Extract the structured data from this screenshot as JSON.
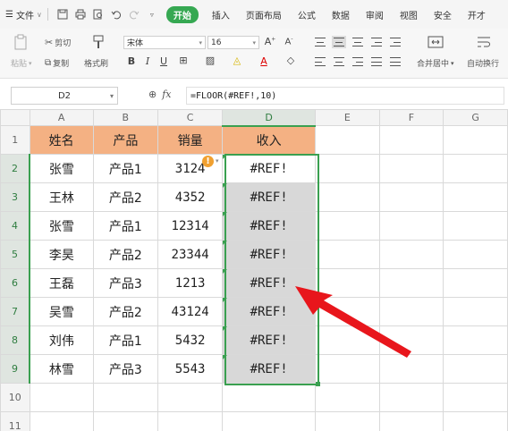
{
  "menubar": {
    "file_label": "文件",
    "tabs": [
      "开始",
      "插入",
      "页面布局",
      "公式",
      "数据",
      "审阅",
      "视图",
      "安全",
      "开才"
    ],
    "active_tab": "开始"
  },
  "ribbon": {
    "paste": "粘贴",
    "cut": "剪切",
    "copy": "复制",
    "format_painter": "格式刷",
    "font_name": "宋体",
    "font_size": "16",
    "merge_center": "合并居中",
    "wrap_text": "自动换行"
  },
  "formula_bar": {
    "cell_ref": "D2",
    "formula": "=FLOOR(#REF!,10)"
  },
  "columns": [
    "A",
    "B",
    "C",
    "D",
    "E",
    "F",
    "G"
  ],
  "rows": [
    "1",
    "2",
    "3",
    "4",
    "5",
    "6",
    "7",
    "8",
    "9",
    "10",
    "11"
  ],
  "table": {
    "headers": [
      "姓名",
      "产品",
      "销量",
      "收入"
    ],
    "data": [
      [
        "张雪",
        "产品1",
        "3124",
        "#REF!"
      ],
      [
        "王林",
        "产品2",
        "4352",
        "#REF!"
      ],
      [
        "张雪",
        "产品1",
        "12314",
        "#REF!"
      ],
      [
        "李昊",
        "产品2",
        "23344",
        "#REF!"
      ],
      [
        "王磊",
        "产品3",
        "1213",
        "#REF!"
      ],
      [
        "吴雪",
        "产品2",
        "43124",
        "#REF!"
      ],
      [
        "刘伟",
        "产品1",
        "5432",
        "#REF!"
      ],
      [
        "林雪",
        "产品3",
        "5543",
        "#REF!"
      ]
    ]
  },
  "colors": {
    "header_fill": "#f4b183",
    "selection": "#3aa050",
    "ref_fill": "#d8d8d8",
    "arrow": "#e8161c",
    "active_tab": "#36a852"
  }
}
